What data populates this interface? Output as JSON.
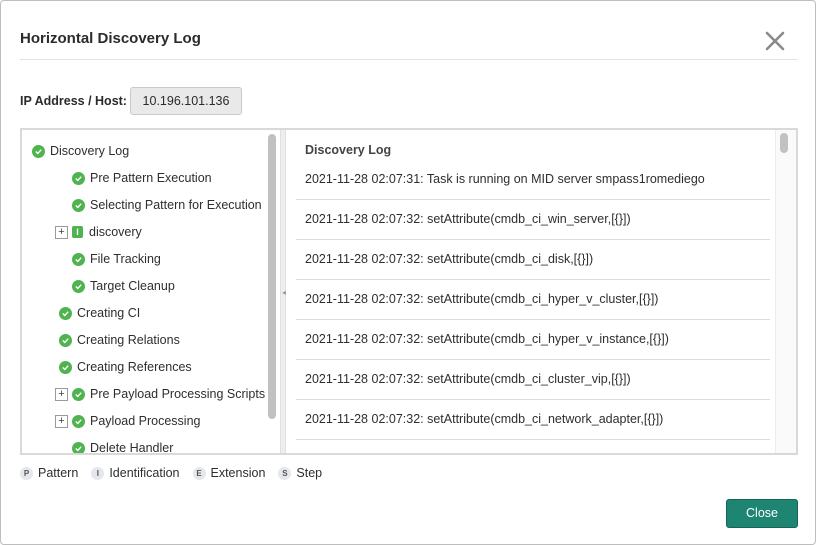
{
  "dialog": {
    "title": "Horizontal Discovery Log",
    "close_icon": "close-icon",
    "close_button_label": "Close"
  },
  "ip": {
    "label": "IP Address / Host:",
    "value": "10.196.101.136"
  },
  "tree": {
    "root": "Discovery Log",
    "items": [
      {
        "label": "Pre Pattern Execution",
        "icon": "check-icon",
        "status_color": "#4fb34f"
      },
      {
        "label": "Selecting Pattern for Execution",
        "icon": "check-icon",
        "status_color": "#4fb34f"
      },
      {
        "label": "discovery",
        "icon": "identification-badge",
        "badge": "I",
        "expandable": true
      },
      {
        "label": "File Tracking",
        "icon": "check-icon"
      },
      {
        "label": "Target Cleanup",
        "icon": "check-icon"
      },
      {
        "label": "Creating CI",
        "icon": "check-icon"
      },
      {
        "label": "Creating Relations",
        "icon": "check-icon"
      },
      {
        "label": "Creating References",
        "icon": "check-icon"
      },
      {
        "label": "Pre Payload Processing Scripts",
        "icon": "check-icon",
        "expandable": true
      },
      {
        "label": "Payload Processing",
        "icon": "check-icon",
        "expandable": true
      },
      {
        "label": "Delete Handler",
        "icon": "check-icon"
      }
    ]
  },
  "log": {
    "title": "Discovery Log",
    "entries": [
      "2021-11-28 02:07:31: Task is running on MID server smpass1romediego",
      "2021-11-28 02:07:32: setAttribute(cmdb_ci_win_server,[{}])",
      "2021-11-28 02:07:32: setAttribute(cmdb_ci_disk,[{}])",
      "2021-11-28 02:07:32: setAttribute(cmdb_ci_hyper_v_cluster,[{}])",
      "2021-11-28 02:07:32: setAttribute(cmdb_ci_hyper_v_instance,[{}])",
      "2021-11-28 02:07:32: setAttribute(cmdb_ci_cluster_vip,[{}])",
      "2021-11-28 02:07:32: setAttribute(cmdb_ci_network_adapter,[{}])"
    ]
  },
  "legend": [
    {
      "badge": "P",
      "label": "Pattern"
    },
    {
      "badge": "I",
      "label": "Identification"
    },
    {
      "badge": "E",
      "label": "Extension"
    },
    {
      "badge": "S",
      "label": "Step"
    }
  ],
  "colors": {
    "accent": "#1f8573",
    "success": "#4fb34f"
  }
}
